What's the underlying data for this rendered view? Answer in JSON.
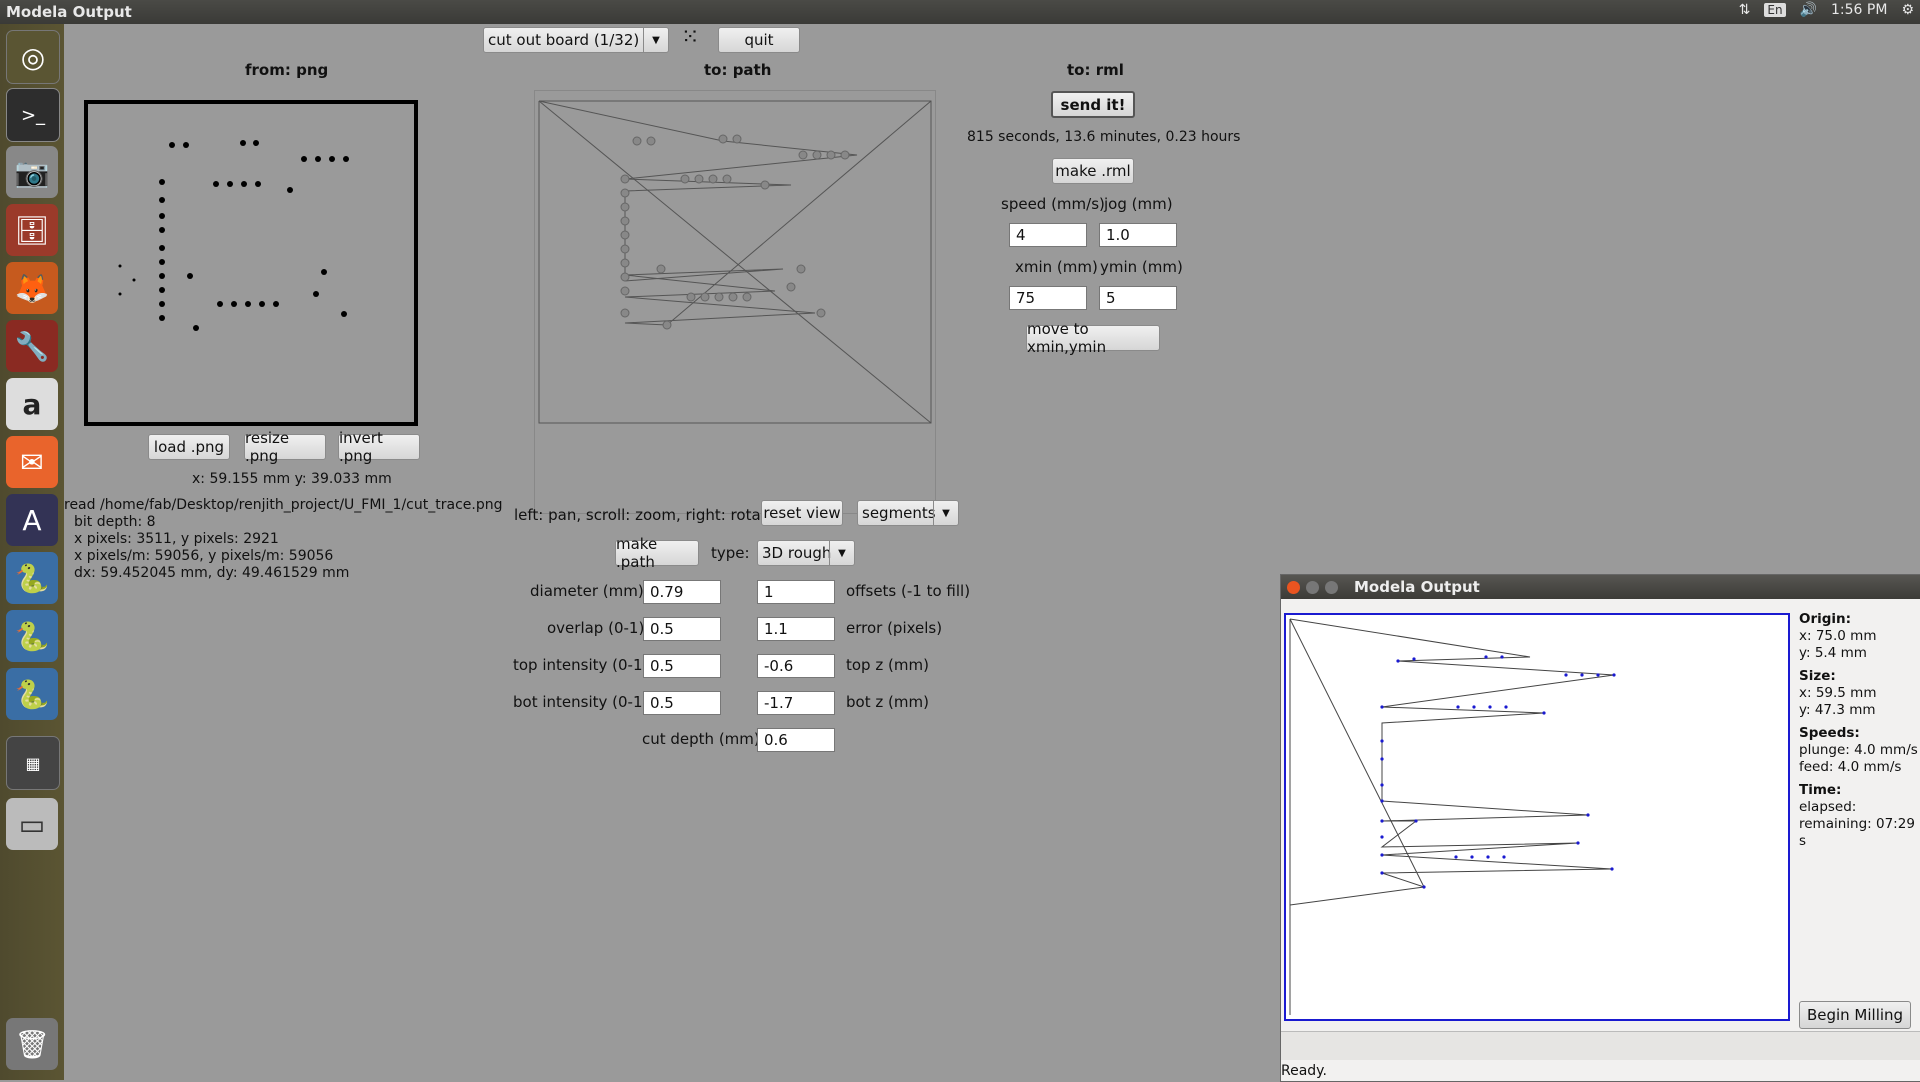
{
  "topbar": {
    "title": "Modela Output",
    "lang": "En",
    "time": "1:56 PM"
  },
  "launcher": {
    "items": [
      "ubuntu-dash-icon",
      "terminal-icon",
      "camera-icon",
      "file-cabinet-icon",
      "firefox-icon",
      "system-settings-icon",
      "amazon-icon",
      "mail-icon",
      "software-updater-icon",
      "python-icon",
      "python-icon",
      "python-icon",
      "workspace-switcher-icon",
      "disk-icon",
      "trash-icon"
    ]
  },
  "toolbar": {
    "process": "cut out board (1/32)",
    "quit": "quit"
  },
  "png": {
    "header": "from: png",
    "load": "load .png",
    "resize": "resize .png",
    "invert": "invert .png",
    "coords": "x: 59.155 mm  y: 39.033 mm",
    "read": "read /home/fab/Desktop/renjith_project/U_FMI_1/cut_trace.png",
    "depth": "bit depth: 8",
    "pixels": "x pixels: 3511, y pixels: 2921",
    "ppm": "x pixels/m: 59056, y pixels/m: 59056",
    "dxdy": "dx: 59.452045 mm, dy: 49.461529 mm"
  },
  "path": {
    "header": "to: path",
    "hint": "left: pan, scroll: zoom, right: rotate",
    "reset": "reset view",
    "view_mode": "segments",
    "make": "make .path",
    "type_label": "type:",
    "type": "3D rough",
    "diameter_label": "diameter (mm)",
    "diameter": "0.79",
    "offsets_label": "offsets (-1 to fill)",
    "offsets": "1",
    "overlap_label": "overlap (0-1)",
    "overlap": "0.5",
    "error_label": "error (pixels)",
    "error": "1.1",
    "topint_label": "top intensity (0-1)",
    "topint": "0.5",
    "topz_label": "top z (mm)",
    "topz": "-0.6",
    "botint_label": "bot intensity (0-1)",
    "botint": "0.5",
    "botz_label": "bot z (mm)",
    "botz": "-1.7",
    "cutdepth_label": "cut depth (mm)",
    "cutdepth": "0.6"
  },
  "rml": {
    "header": "to: rml",
    "send": "send it!",
    "time": "815 seconds, 13.6 minutes, 0.23 hours",
    "make": "make .rml",
    "speed_label": "speed (mm/s)",
    "speed": "4",
    "jog_label": "jog (mm)",
    "jog": "1.0",
    "xmin_label": "xmin (mm)",
    "xmin": "75",
    "ymin_label": "ymin (mm)",
    "ymin": "5",
    "move": "move to xmin,ymin"
  },
  "modela": {
    "title": "Modela Output",
    "origin_h": "Origin:",
    "origin_x": "x: 75.0 mm",
    "origin_y": "y: 5.4 mm",
    "size_h": "Size:",
    "size_x": "x: 59.5 mm",
    "size_y": "y: 47.3 mm",
    "speeds_h": "Speeds:",
    "plunge": "plunge: 4.0 mm/s",
    "feed": "feed: 4.0 mm/s",
    "time_h": "Time:",
    "elapsed": "elapsed:",
    "remaining": "remaining: 07:29 s",
    "begin": "Begin Milling",
    "status": "Ready."
  },
  "colors": {
    "bg": "#9a9a9a",
    "launcher": "#554f30",
    "path_blue": "#1a1ad0"
  }
}
